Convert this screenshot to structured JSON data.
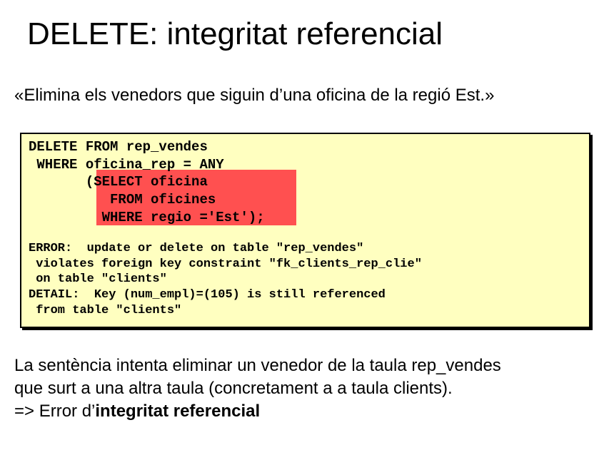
{
  "title": "DELETE: integritat referencial",
  "quote": "«Elimina els venedors que siguin d’una oficina de la regió Est.»",
  "sql": {
    "lines": [
      "DELETE FROM rep_vendes",
      " WHERE oficina_rep = ANY",
      "       (SELECT oficina",
      "          FROM oficines",
      "         WHERE regio ='Est');"
    ]
  },
  "error": {
    "lines": [
      "ERROR:  update or delete on table \"rep_vendes\"",
      " violates foreign key constraint \"fk_clients_rep_clie\"",
      " on table \"clients\"",
      "DETAIL:  Key (num_empl)=(105) is still referenced",
      " from table \"clients\""
    ]
  },
  "explanation": {
    "line1": "La sentència intenta eliminar un venedor de la taula rep_vendes",
    "line2": "que surt a una altra taula (concretament a a taula clients).",
    "line3_prefix": "=> Error d’",
    "line3_bold": "integritat referencial"
  },
  "colors": {
    "code_background": "#ffffc0",
    "highlight": "#ff5050"
  }
}
